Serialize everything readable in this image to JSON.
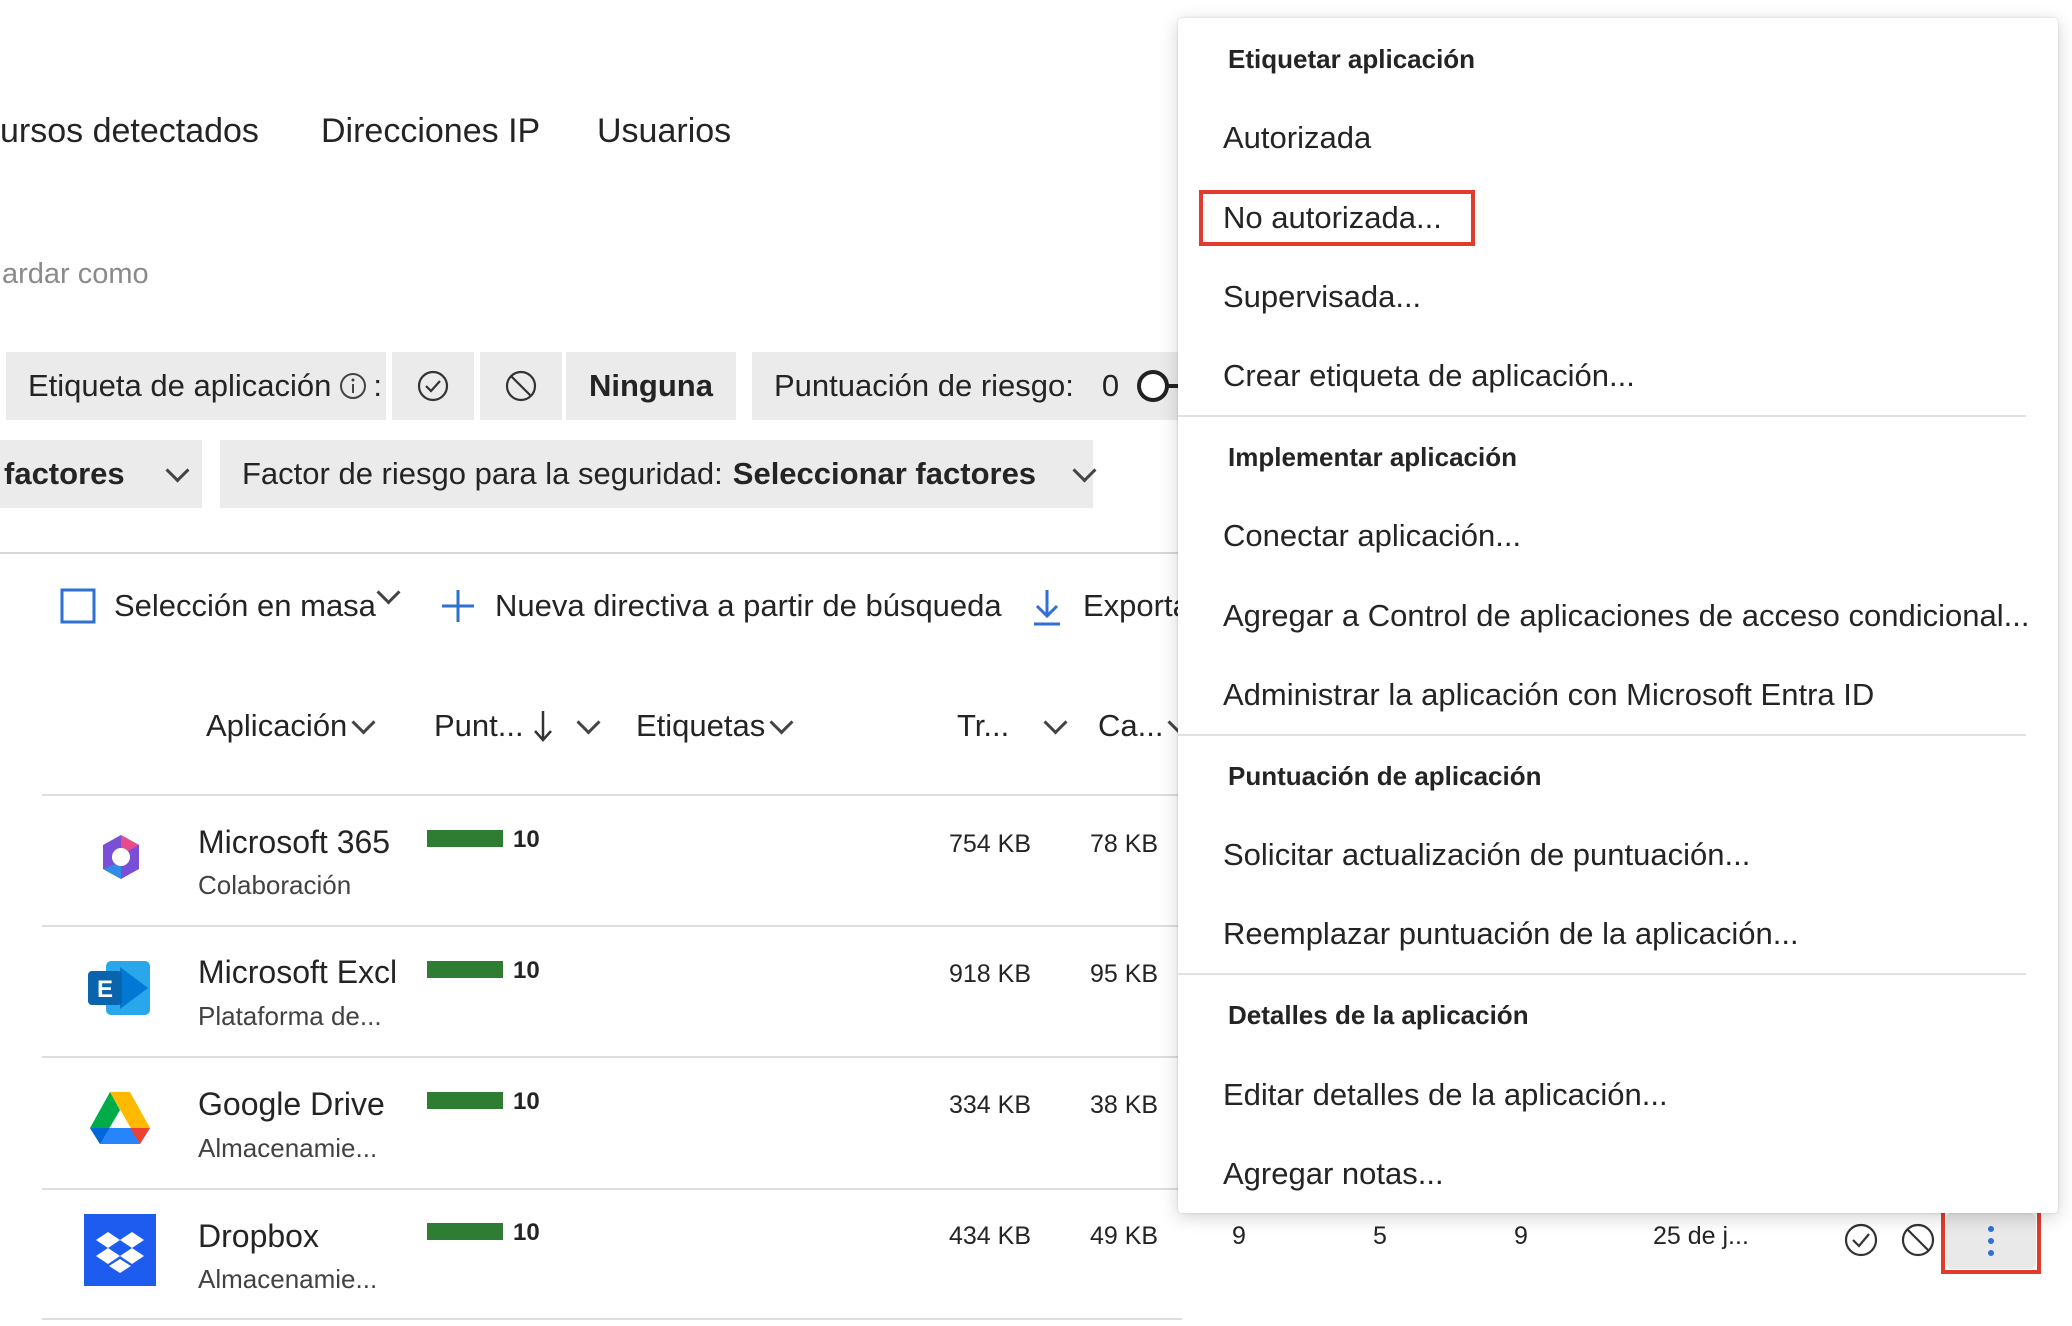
{
  "tabs": [
    "ursos detectados",
    "Direcciones IP",
    "Usuarios"
  ],
  "save_as_label": "ardar como",
  "filters": {
    "app_tag_label": "Etiqueta de aplicación",
    "app_tag_colon": ":",
    "app_tag_none": "Ninguna",
    "risk_score_label": "Puntuación de riesgo:",
    "risk_score_value": "0",
    "factors_partial": "factores",
    "security_factor_label": "Factor de riesgo para la seguridad:",
    "security_factor_value": "Seleccionar factores"
  },
  "toolbar": {
    "bulk_select": "Selección en masa",
    "new_policy": "Nueva directiva a partir de búsqueda",
    "export": "Exporta"
  },
  "columns": [
    "Aplicación",
    "Punt...",
    "Etiquetas",
    "Tr...",
    "Ca..."
  ],
  "rows": [
    {
      "name": "Microsoft 365",
      "category": "Colaboración",
      "score": "10",
      "score_fill": 1.0,
      "traffic": "754 KB",
      "ca": "78 KB",
      "icon": "microsoft-365-icon"
    },
    {
      "name": "Microsoft Excl",
      "category": "Plataforma de...",
      "score": "10",
      "score_fill": 1.0,
      "traffic": "918 KB",
      "ca": "95 KB",
      "icon": "microsoft-exchange-icon"
    },
    {
      "name": "Google Drive",
      "category": "Almacenamie...",
      "score": "10",
      "score_fill": 1.0,
      "traffic": "334 KB",
      "ca": "38 KB",
      "icon": "google-drive-icon"
    },
    {
      "name": "Dropbox",
      "category": "Almacenamie...",
      "score": "10",
      "score_fill": 1.0,
      "traffic": "434 KB",
      "ca": "49 KB",
      "c1": "9",
      "c2": "5",
      "c3": "9",
      "date": "25 de j...",
      "icon": "dropbox-icon"
    }
  ],
  "menu": {
    "sections": [
      {
        "header": "Etiquetar aplicación",
        "items": [
          "Autorizada",
          "No autorizada...",
          "Supervisada...",
          "Crear etiqueta de aplicación..."
        ]
      },
      {
        "header": "Implementar aplicación",
        "items": [
          "Conectar aplicación...",
          "Agregar a Control de aplicaciones de acceso condicional...",
          "Administrar la aplicación con Microsoft Entra ID"
        ]
      },
      {
        "header": "Puntuación de aplicación",
        "items": [
          "Solicitar actualización de puntuación...",
          "Reemplazar puntuación de la aplicación..."
        ]
      },
      {
        "header": "Detalles de la aplicación",
        "items": [
          "Editar detalles de la aplicación...",
          "Agregar notas..."
        ]
      }
    ]
  },
  "colors": {
    "accent": "#2f6fd6",
    "score_green": "#2f7d32",
    "highlight_red": "#e23b2e",
    "chip_bg": "#ebebeb"
  }
}
